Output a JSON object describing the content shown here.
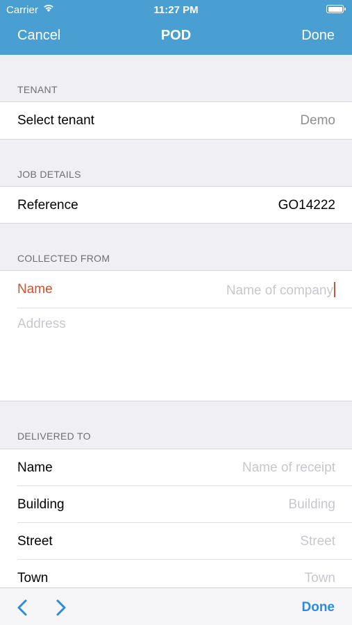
{
  "status_bar": {
    "carrier": "Carrier",
    "time": "11:27 PM",
    "icons": [
      "wifi-icon",
      "battery-icon"
    ]
  },
  "nav": {
    "cancel_label": "Cancel",
    "title": "POD",
    "done_label": "Done",
    "background": "#4a9fd2"
  },
  "sections": {
    "tenant": {
      "header": "TENANT",
      "select_label": "Select tenant",
      "select_value": "Demo"
    },
    "job_details": {
      "header": "JOB DETAILS",
      "reference_label": "Reference",
      "reference_value": "GO14222"
    },
    "collected_from": {
      "header": "COLLECTED FROM",
      "name_label": "Name",
      "name_placeholder": "Name of company",
      "address_placeholder": "Address"
    },
    "delivered_to": {
      "header": "DELIVERED TO",
      "name_label": "Name",
      "name_placeholder": "Name of receipt",
      "building_label": "Building",
      "building_placeholder": "Building",
      "street_label": "Street",
      "street_placeholder": "Street",
      "town_label": "Town",
      "town_placeholder": "Town"
    }
  },
  "toolbar": {
    "done_label": "Done",
    "icons": [
      "chevron-left-icon",
      "chevron-right-icon"
    ],
    "accent": "#2b8be0"
  },
  "colors": {
    "error_label": "#d4502f",
    "placeholder": "#c7c7cd",
    "group_background": "#efeff4"
  }
}
